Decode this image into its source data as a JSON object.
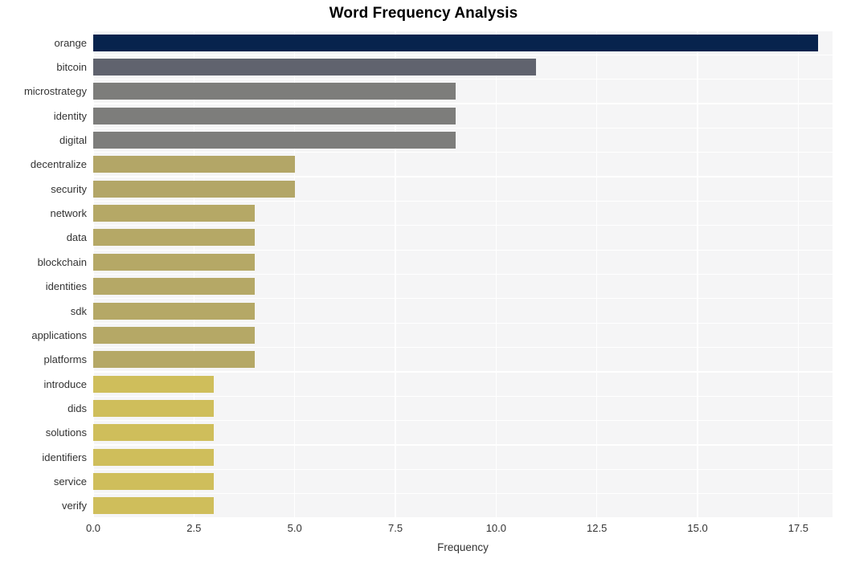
{
  "chart_data": {
    "type": "bar",
    "orientation": "horizontal",
    "title": "Word Frequency Analysis",
    "xlabel": "Frequency",
    "ylabel": "",
    "xlim": [
      0,
      18.35
    ],
    "xticks": [
      "0.0",
      "2.5",
      "5.0",
      "7.5",
      "10.0",
      "12.5",
      "15.0",
      "17.5"
    ],
    "xtick_values": [
      0.0,
      2.5,
      5.0,
      7.5,
      10.0,
      12.5,
      15.0,
      17.5
    ],
    "grid": true,
    "legend": null,
    "categories": [
      "orange",
      "bitcoin",
      "microstrategy",
      "identity",
      "digital",
      "decentralize",
      "security",
      "network",
      "data",
      "blockchain",
      "identities",
      "sdk",
      "applications",
      "platforms",
      "introduce",
      "dids",
      "solutions",
      "identifiers",
      "service",
      "verify"
    ],
    "values": [
      18,
      11,
      9,
      9,
      9,
      5,
      5,
      4,
      4,
      4,
      4,
      4,
      4,
      4,
      3,
      3,
      3,
      3,
      3,
      3
    ],
    "bar_colors": [
      "#07234d",
      "#60636e",
      "#7d7d7b",
      "#7d7d7b",
      "#7d7d7b",
      "#b3a667",
      "#b3a667",
      "#b5a866",
      "#b5a866",
      "#b5a866",
      "#b5a866",
      "#b5a866",
      "#b5a866",
      "#b5a866",
      "#cfbe5b",
      "#cfbe5b",
      "#cfbe5b",
      "#cfbe5b",
      "#cfbe5b",
      "#cfbe5b"
    ]
  },
  "style": {
    "plot_background": "#f5f5f6",
    "figure_background": "#ffffff",
    "gridline_color": "#ffffff",
    "text_color": "#333333",
    "title_color": "#000000"
  }
}
